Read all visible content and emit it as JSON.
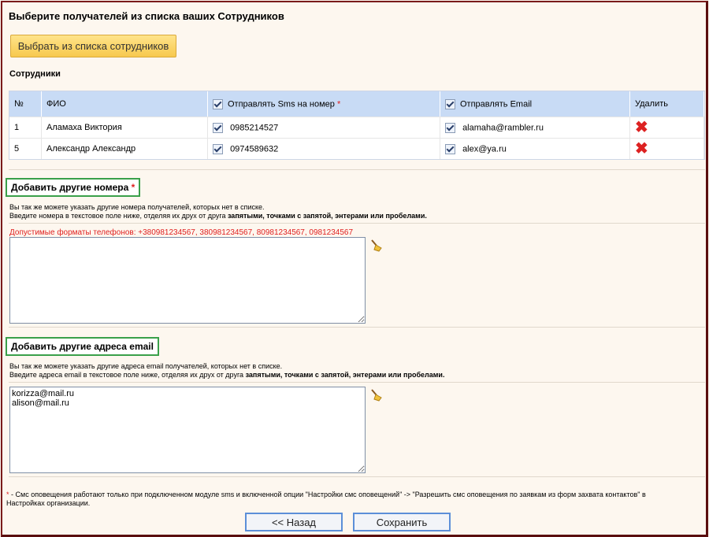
{
  "header": {
    "title": "Выберите получателей из списка ваших Сотрудников",
    "choose_button": "Выбрать из списка сотрудников"
  },
  "employees": {
    "label": "Сотрудники",
    "columns": {
      "num": "№",
      "name": "ФИО",
      "sms": "Отправлять Sms на номер",
      "sms_required": "*",
      "email": "Отправлять Email",
      "delete": "Удалить"
    },
    "rows": [
      {
        "num": "1",
        "name": "Аламаха Виктория",
        "phone": "0985214527",
        "email": "alamaha@rambler.ru"
      },
      {
        "num": "5",
        "name": "Александр Александр",
        "phone": "0974589632",
        "email": "alex@ya.ru"
      }
    ]
  },
  "phones": {
    "heading": "Добавить другие номера",
    "required": "*",
    "help_line1": "Вы так же можете указать другие номера получателей, которых нет в списке.",
    "help_line2_prefix": "Введите номера в текстовое поле ниже, отделяя их друх от друга ",
    "help_line2_bold": "запятыми, точками с запятой, энтерами или пробелами.",
    "formats": "Допустимые форматы телефонов: +380981234567, 380981234567, 80981234567, 0981234567",
    "value": ""
  },
  "emails": {
    "heading": "Добавить другие адреса email",
    "help_line1": "Вы так же можете указать другие адреса email получателей, которых нет в списке.",
    "help_line2_prefix": "Введите адреса email в текстовое поле ниже, отделяя их друх от друга ",
    "help_line2_bold": "запятыми, точками с запятой, энтерами или пробелами.",
    "value": "korizza@mail.ru\nalison@mail.ru"
  },
  "footnote": {
    "star": "*",
    "text": " - Смс оповещения работают только при подключенном модуле sms и включенной опции \"Настройки смс оповещений\" -> \"Разрешить смс оповещения по заявкам из форм захвата контактов\" в Настройках организации."
  },
  "actions": {
    "back": "<< Назад",
    "save": "Сохранить"
  },
  "colors": {
    "border": "#7a1a1a",
    "accent_green": "#3aa04a",
    "required_red": "#e02020",
    "button_blue": "#5c8fd8"
  },
  "icons": {
    "delete": "delete-x-icon",
    "clear": "broom-icon"
  }
}
